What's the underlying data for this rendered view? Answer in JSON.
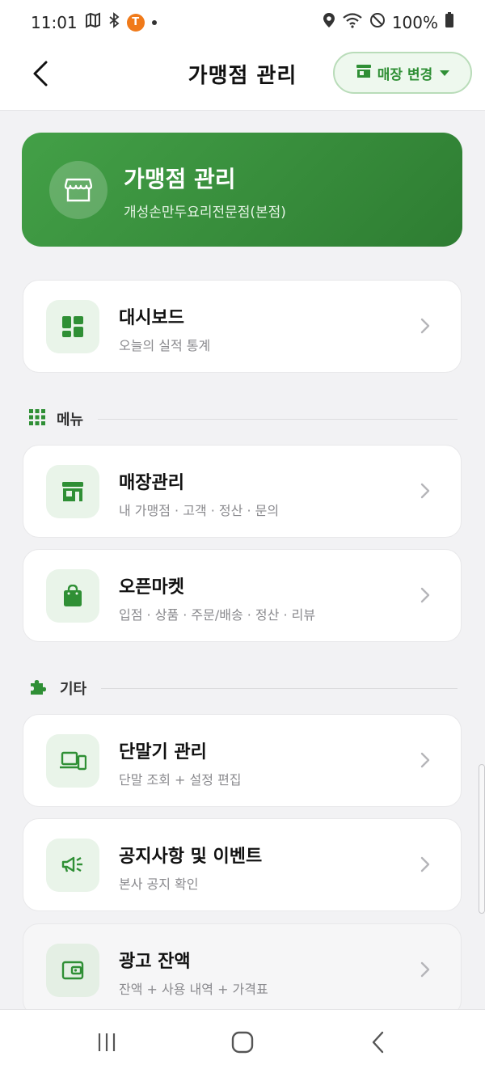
{
  "status_bar": {
    "time": "11:01",
    "notification_icons": [
      "map-icon",
      "bluetooth-icon",
      "t-app-icon",
      "dot"
    ],
    "t_badge_letter": "T",
    "right_icons": [
      "location-icon",
      "wifi-icon",
      "do-not-disturb-icon",
      "battery-icon"
    ],
    "battery": "100%"
  },
  "header": {
    "title": "가맹점 관리",
    "store_change_label": "매장 변경"
  },
  "hero": {
    "title": "가맹점 관리",
    "subtitle": "개성손만두요리전문점(본점)"
  },
  "dashboard": {
    "title": "대시보드",
    "subtitle": "오늘의 실적 통계"
  },
  "sections": {
    "menu": "메뉴",
    "etc": "기타"
  },
  "menu_items": [
    {
      "title": "매장관리",
      "subtitle": "내 가맹점 · 고객 · 정산 · 문의"
    },
    {
      "title": "오픈마켓",
      "subtitle": "입점 · 상품 · 주문/배송 · 정산 · 리뷰"
    }
  ],
  "etc_items": [
    {
      "title": "단말기 관리",
      "subtitle": "단말 조회 + 설정 편집"
    },
    {
      "title": "공지사항 및 이벤트",
      "subtitle": "본사 공지 확인"
    },
    {
      "title": "광고 잔액",
      "subtitle": "잔액 + 사용 내역 + 가격표"
    }
  ],
  "colors": {
    "accent": "#2f8f35",
    "hero_start": "#43a047",
    "hero_end": "#2e7d32",
    "icon_bg": "#e9f4e9",
    "background": "#f2f2f4"
  }
}
